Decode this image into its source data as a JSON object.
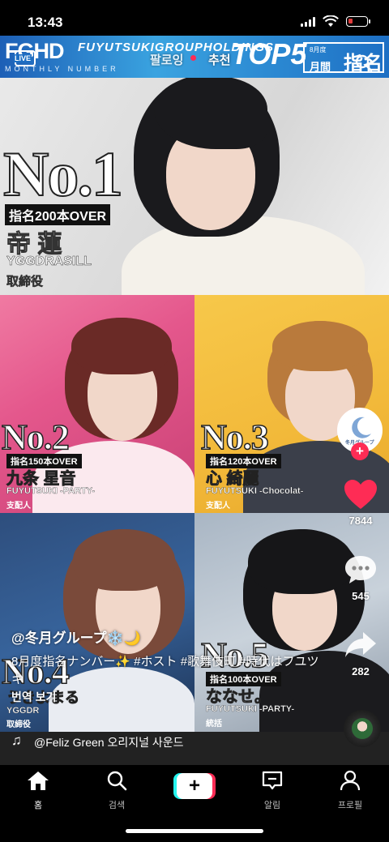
{
  "status_bar": {
    "time": "13:43"
  },
  "banner": {
    "brand": "FGHD",
    "group": "FUYUTSUKIGROUPHOLDINGS",
    "subtitle": "MONTHLY NUMBER",
    "top": "TOP5",
    "month_small": "8月度",
    "month_label": "月間",
    "nomination": "指名"
  },
  "top_nav": {
    "live_label": "LIVE",
    "tab_following": "팔로잉",
    "tab_foryou": "추천"
  },
  "ranking": {
    "no1": {
      "rank": "No.1",
      "tag": "指名200本OVER",
      "name": "帝 蓮",
      "club": "YGGDRASILL",
      "role": "取締役"
    },
    "no2": {
      "rank": "No.2",
      "tag": "指名150本OVER",
      "name": "九条 星音",
      "club": "FUYUTSUKI -PARTY-",
      "role": "支配人"
    },
    "no3": {
      "rank": "No.3",
      "tag": "指名120本OVER",
      "name": "心 綺麗",
      "club": "FUYUTSUKI -Chocolat-",
      "role": "支配人"
    },
    "no4": {
      "rank": "No.4",
      "tag": "",
      "name": "うきよまる",
      "club": "YGGDR",
      "role": "取締役"
    },
    "no5": {
      "rank": "No.5",
      "tag": "指名100本OVER",
      "name": "ななせ。",
      "club": "FUYUTSUKI -PARTY-",
      "role": "統括"
    }
  },
  "right_rail": {
    "account_logo_text": "冬月グループ",
    "like_count": "7844",
    "comment_count": "545",
    "share_count": "282"
  },
  "caption": {
    "username": "@冬月グループ❄️🌙",
    "description": "8月度指名ナンバー✨ #ホスト #歌舞伎町 #時代はフユツキ",
    "translate": "번역 보기"
  },
  "music": {
    "text": "@Feliz Green 오리지널 사운드"
  },
  "bottom_nav": {
    "home": "홈",
    "search": "검색",
    "inbox": "알림",
    "profile": "프로필"
  },
  "colors": {
    "accent_red": "#fe2c55",
    "accent_cyan": "#25f4ee",
    "banner_blue": "#1d6fc4"
  }
}
